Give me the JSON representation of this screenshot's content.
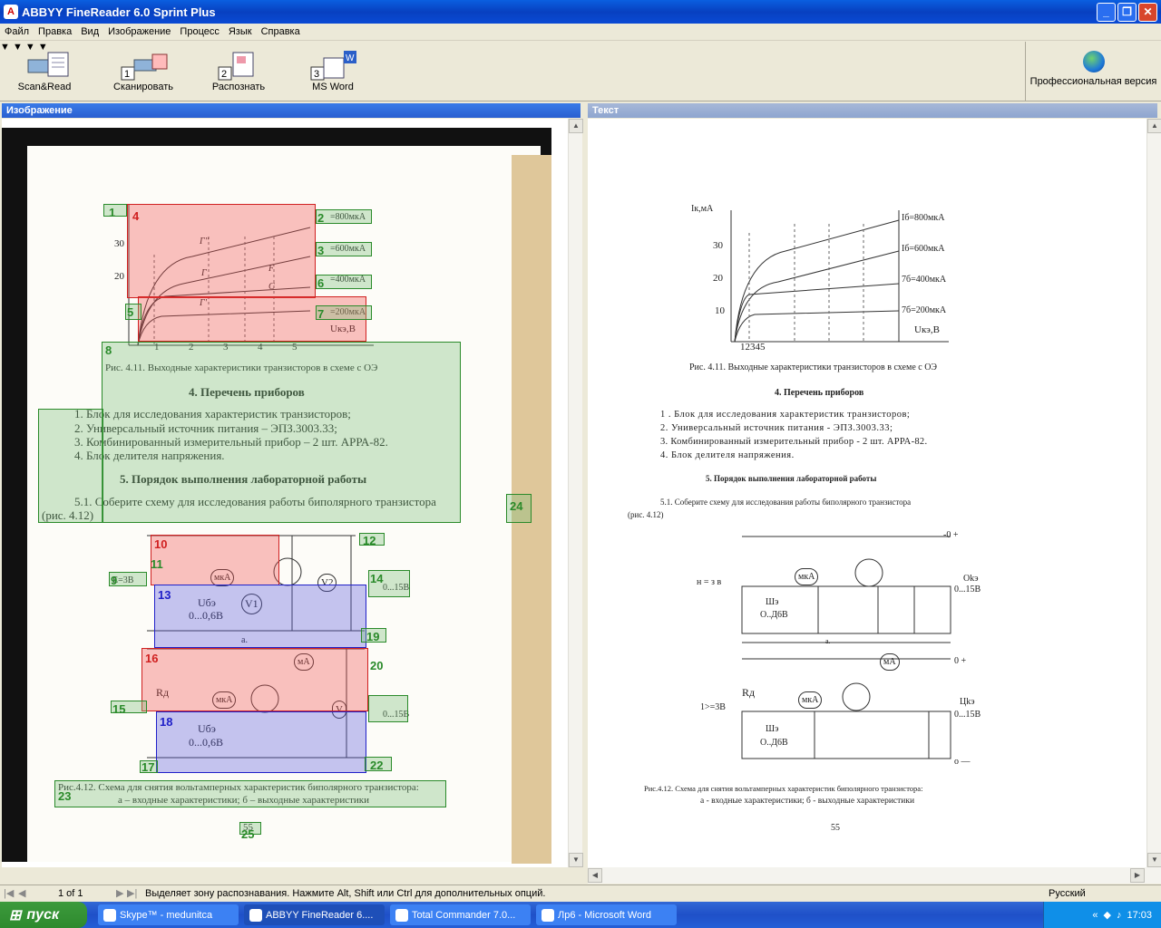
{
  "window": {
    "title": "ABBYY FineReader 6.0 Sprint Plus"
  },
  "menu": [
    "Файл",
    "Правка",
    "Вид",
    "Изображение",
    "Процесс",
    "Язык",
    "Справка"
  ],
  "toolbar": {
    "scan_read": "Scan&Read",
    "scan": "Сканировать",
    "recognize": "Распознать",
    "msword": "MS Word",
    "pro": "Профессиональная версия"
  },
  "panes": {
    "image": "Изображение",
    "text": "Текст"
  },
  "document": {
    "fig1_caption": "Рис. 4.11. Выходные характеристики транзисторов в схеме с ОЭ",
    "h4": "4. Перечень приборов",
    "items": [
      "1. Блок для исследования характеристик транзисторов;",
      "2. Универсальный источник питания – ЭПЗ.3003.33;",
      "3. Комбинированный измерительный прибор – 2 шт. АРРА-82.",
      "4. Блок делителя напряжения."
    ],
    "h5": "5. Порядок выполнения лабораторной работы",
    "p51": "5.1. Соберите схему для исследования работы биполярного транзистора",
    "p51b": "(рис. 4.12)",
    "fig2_caption1": "Рис.4.12. Схема для снятия вольтамперных характеристик биполярного транзистора:",
    "fig2_caption2": "а – входные характеристики; б – выходные характеристики",
    "page": "55",
    "curves": [
      "=800мкА",
      "=600мкА",
      "=400мкА",
      "=200мкА"
    ],
    "curve_labels": [
      "Г''",
      "Г",
      "F",
      "С",
      "Г'"
    ],
    "yticks": [
      "30",
      "20",
      "10"
    ],
    "xticks": [
      "1",
      "2",
      "3",
      "4",
      "5"
    ],
    "uke": "Uкэ,В",
    "ike": "Iк,мА",
    "ube": "Uбэ",
    "ube_range": "0...0,6В",
    "uke_range": "0...15В",
    "mka": "мкА",
    "ma": "мА",
    "v1": "V1",
    "v2": "V2",
    "v": "V",
    "rd": "Rд",
    "ukb": "Uкэ",
    "a": "а.",
    "b": "б.",
    "e3": "Е=3В"
  },
  "ocr_text": {
    "fig1_caption": "Рис. 4.11. Выходные характеристики транзисторов в схеме с ОЭ",
    "h4": "4. Перечень приборов",
    "items": [
      "1 .  Блок для исследования характеристик транзисторов;",
      "2. Универсальный источник питания - ЭПЗ.3003.33;",
      "3. Комбинированный измерительный прибор - 2 шт. АРРА-82.",
      "4. Блок делителя напряжения."
    ],
    "h5": "5. Порядок выполнения лабораторной работы",
    "p51": "5.1. Соберите схему для исследования работы биполярного транзистора",
    "p51b": "(рис. 4.12)",
    "fig2_caption1": "Рис.4.12. Схема для снятия вольтамперных характеристик биполярного транзистора:",
    "fig2_caption2": "а  -  входные  характеристики;  б  -  выходные  характеристики",
    "page": "55",
    "curves": [
      "Iб=800мкА",
      "Iб=600мкА",
      "7б=400мкА",
      "7б=200мкА"
    ],
    "xticks": "12345",
    "okw": "Оkэ",
    "ckw": "Цkэ",
    "range": "0...15В",
    "she": "Шэ",
    "she_range": "О..Д6В",
    "n3": "н = з в",
    "e3": "1>=3В",
    "ka": "кА",
    "x0": "-0 +",
    "o0": "0 +",
    "o_": "о —"
  },
  "status": {
    "pages": "1 of 1",
    "message": "Выделяет зону распознавания. Нажмите Alt, Shift или Ctrl для дополнительных опций.",
    "lang": "Русский"
  },
  "taskbar": {
    "start": "пуск",
    "tasks": [
      "Skype™ - medunitca",
      "ABBYY FineReader 6....",
      "Total Commander 7.0...",
      "Лр6 - Microsoft Word"
    ],
    "lang": "RU",
    "time": "17:03"
  },
  "zones": [
    "1",
    "2",
    "3",
    "4",
    "5",
    "6",
    "7",
    "8",
    "9",
    "10",
    "11",
    "12",
    "13",
    "14",
    "15",
    "16",
    "17",
    "18",
    "19",
    "20",
    "21",
    "22",
    "23",
    "24",
    "25"
  ]
}
